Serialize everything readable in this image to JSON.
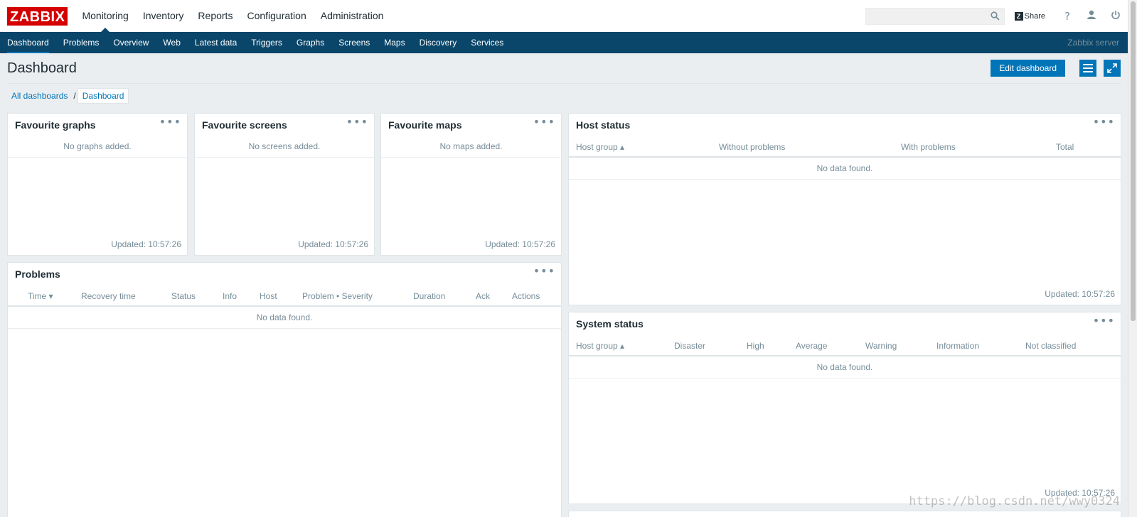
{
  "topbar": {
    "logo": "ZABBIX",
    "nav": [
      "Monitoring",
      "Inventory",
      "Reports",
      "Configuration",
      "Administration"
    ],
    "search_value": "",
    "share_label": "Share",
    "help_glyph": "?",
    "icons": [
      "search-icon",
      "share-icon",
      "help-icon",
      "user-icon",
      "power-icon"
    ]
  },
  "subbar": {
    "nav": [
      "Dashboard",
      "Problems",
      "Overview",
      "Web",
      "Latest data",
      "Triggers",
      "Graphs",
      "Screens",
      "Maps",
      "Discovery",
      "Services"
    ],
    "server": "Zabbix server"
  },
  "page": {
    "title": "Dashboard",
    "edit_label": "Edit dashboard",
    "breadcrumb": {
      "all": "All dashboards",
      "sep": "/",
      "current": "Dashboard"
    }
  },
  "widgets": {
    "menu_glyph": "•••",
    "fav_graphs": {
      "title": "Favourite graphs",
      "empty": "No graphs added.",
      "updated": "Updated: 10:57:26"
    },
    "fav_screens": {
      "title": "Favourite screens",
      "empty": "No screens added.",
      "updated": "Updated: 10:57:26"
    },
    "fav_maps": {
      "title": "Favourite maps",
      "empty": "No maps added.",
      "updated": "Updated: 10:57:26"
    },
    "problems": {
      "title": "Problems",
      "columns": [
        "Time ▾",
        "Recovery time",
        "Status",
        "Info",
        "Host",
        "Problem • Severity",
        "Duration",
        "Ack",
        "Actions"
      ],
      "empty": "No data found."
    },
    "host_status": {
      "title": "Host status",
      "columns": [
        "Host group ▴",
        "Without problems",
        "With problems",
        "Total"
      ],
      "empty": "No data found.",
      "updated": "Updated: 10:57:26"
    },
    "system_status": {
      "title": "System status",
      "columns": [
        "Host group ▴",
        "Disaster",
        "High",
        "Average",
        "Warning",
        "Information",
        "Not classified"
      ],
      "empty": "No data found.",
      "updated": "Updated: 10:57:26"
    }
  },
  "watermark": "https://blog.csdn.net/wwy0324",
  "colors": {
    "brand": "#d40000",
    "nav_bg": "#0a466a",
    "accent": "#0275b8",
    "muted": "#768d99"
  }
}
